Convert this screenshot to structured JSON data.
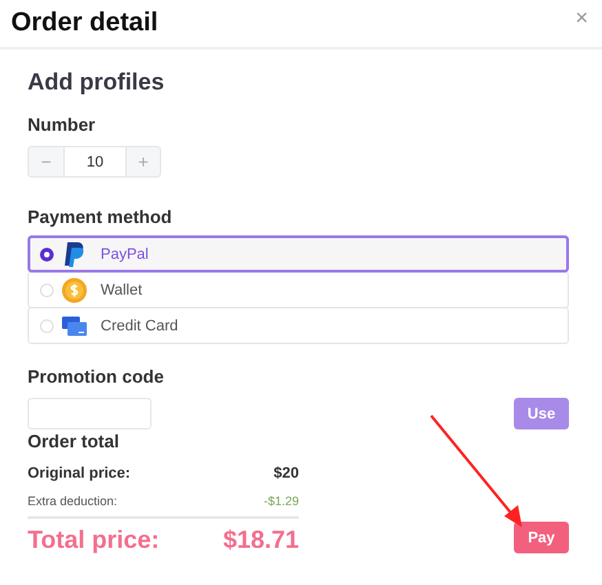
{
  "window": {
    "title": "Order detail",
    "close": "×"
  },
  "section_title": "Add profiles",
  "number": {
    "label": "Number",
    "minus": "−",
    "value": "10",
    "plus": "+"
  },
  "payment": {
    "label": "Payment method",
    "options": [
      {
        "label": "PayPal",
        "kind": "paypal",
        "selected": true
      },
      {
        "label": "Wallet",
        "kind": "wallet",
        "selected": false
      },
      {
        "label": "Credit Card",
        "kind": "card",
        "selected": false
      }
    ]
  },
  "promotion": {
    "label": "Promotion code",
    "button": "Use"
  },
  "order_total": {
    "title": "Order total",
    "original_label": "Original price:",
    "original_value": "$20",
    "deduction_label": "Extra deduction:",
    "deduction_value": "-$1.29",
    "total_label": "Total price:",
    "total_value": "$18.71",
    "pay_button": "Pay"
  }
}
